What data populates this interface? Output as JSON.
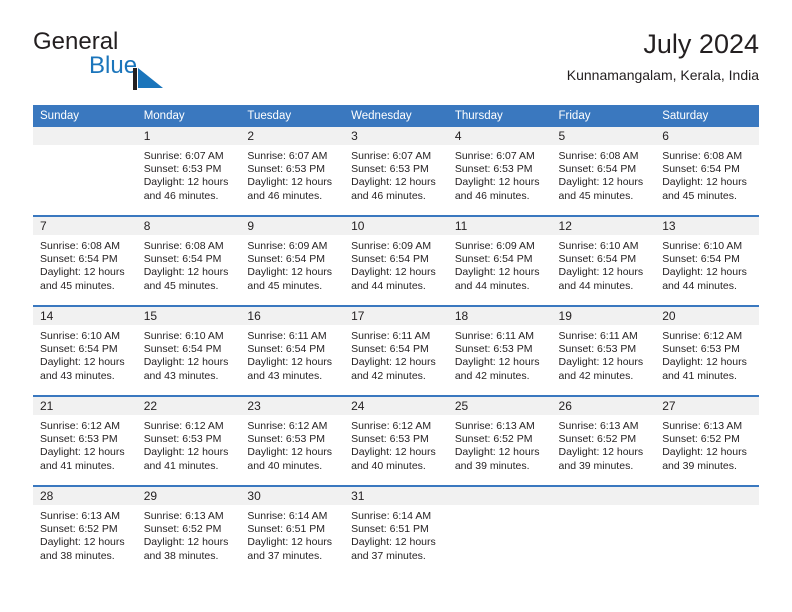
{
  "brand": {
    "name_part1": "General",
    "name_part2": "Blue",
    "logo_icon": "triangle-flag-icon",
    "accent_color": "#1b75bb"
  },
  "header": {
    "title": "July 2024",
    "subtitle": "Kunnamangalam, Kerala, India"
  },
  "theme": {
    "header_row_bg": "#3a78bf",
    "daynum_band_bg": "#f1f1f1",
    "text_color": "#231f20"
  },
  "calendar": {
    "weekday_headers": [
      "Sunday",
      "Monday",
      "Tuesday",
      "Wednesday",
      "Thursday",
      "Friday",
      "Saturday"
    ],
    "weeks": [
      [
        {
          "day": "",
          "sunrise": "",
          "sunset": "",
          "daylight_line1": "",
          "daylight_line2": ""
        },
        {
          "day": "1",
          "sunrise": "Sunrise: 6:07 AM",
          "sunset": "Sunset: 6:53 PM",
          "daylight_line1": "Daylight: 12 hours",
          "daylight_line2": "and 46 minutes."
        },
        {
          "day": "2",
          "sunrise": "Sunrise: 6:07 AM",
          "sunset": "Sunset: 6:53 PM",
          "daylight_line1": "Daylight: 12 hours",
          "daylight_line2": "and 46 minutes."
        },
        {
          "day": "3",
          "sunrise": "Sunrise: 6:07 AM",
          "sunset": "Sunset: 6:53 PM",
          "daylight_line1": "Daylight: 12 hours",
          "daylight_line2": "and 46 minutes."
        },
        {
          "day": "4",
          "sunrise": "Sunrise: 6:07 AM",
          "sunset": "Sunset: 6:53 PM",
          "daylight_line1": "Daylight: 12 hours",
          "daylight_line2": "and 46 minutes."
        },
        {
          "day": "5",
          "sunrise": "Sunrise: 6:08 AM",
          "sunset": "Sunset: 6:54 PM",
          "daylight_line1": "Daylight: 12 hours",
          "daylight_line2": "and 45 minutes."
        },
        {
          "day": "6",
          "sunrise": "Sunrise: 6:08 AM",
          "sunset": "Sunset: 6:54 PM",
          "daylight_line1": "Daylight: 12 hours",
          "daylight_line2": "and 45 minutes."
        }
      ],
      [
        {
          "day": "7",
          "sunrise": "Sunrise: 6:08 AM",
          "sunset": "Sunset: 6:54 PM",
          "daylight_line1": "Daylight: 12 hours",
          "daylight_line2": "and 45 minutes."
        },
        {
          "day": "8",
          "sunrise": "Sunrise: 6:08 AM",
          "sunset": "Sunset: 6:54 PM",
          "daylight_line1": "Daylight: 12 hours",
          "daylight_line2": "and 45 minutes."
        },
        {
          "day": "9",
          "sunrise": "Sunrise: 6:09 AM",
          "sunset": "Sunset: 6:54 PM",
          "daylight_line1": "Daylight: 12 hours",
          "daylight_line2": "and 45 minutes."
        },
        {
          "day": "10",
          "sunrise": "Sunrise: 6:09 AM",
          "sunset": "Sunset: 6:54 PM",
          "daylight_line1": "Daylight: 12 hours",
          "daylight_line2": "and 44 minutes."
        },
        {
          "day": "11",
          "sunrise": "Sunrise: 6:09 AM",
          "sunset": "Sunset: 6:54 PM",
          "daylight_line1": "Daylight: 12 hours",
          "daylight_line2": "and 44 minutes."
        },
        {
          "day": "12",
          "sunrise": "Sunrise: 6:10 AM",
          "sunset": "Sunset: 6:54 PM",
          "daylight_line1": "Daylight: 12 hours",
          "daylight_line2": "and 44 minutes."
        },
        {
          "day": "13",
          "sunrise": "Sunrise: 6:10 AM",
          "sunset": "Sunset: 6:54 PM",
          "daylight_line1": "Daylight: 12 hours",
          "daylight_line2": "and 44 minutes."
        }
      ],
      [
        {
          "day": "14",
          "sunrise": "Sunrise: 6:10 AM",
          "sunset": "Sunset: 6:54 PM",
          "daylight_line1": "Daylight: 12 hours",
          "daylight_line2": "and 43 minutes."
        },
        {
          "day": "15",
          "sunrise": "Sunrise: 6:10 AM",
          "sunset": "Sunset: 6:54 PM",
          "daylight_line1": "Daylight: 12 hours",
          "daylight_line2": "and 43 minutes."
        },
        {
          "day": "16",
          "sunrise": "Sunrise: 6:11 AM",
          "sunset": "Sunset: 6:54 PM",
          "daylight_line1": "Daylight: 12 hours",
          "daylight_line2": "and 43 minutes."
        },
        {
          "day": "17",
          "sunrise": "Sunrise: 6:11 AM",
          "sunset": "Sunset: 6:54 PM",
          "daylight_line1": "Daylight: 12 hours",
          "daylight_line2": "and 42 minutes."
        },
        {
          "day": "18",
          "sunrise": "Sunrise: 6:11 AM",
          "sunset": "Sunset: 6:53 PM",
          "daylight_line1": "Daylight: 12 hours",
          "daylight_line2": "and 42 minutes."
        },
        {
          "day": "19",
          "sunrise": "Sunrise: 6:11 AM",
          "sunset": "Sunset: 6:53 PM",
          "daylight_line1": "Daylight: 12 hours",
          "daylight_line2": "and 42 minutes."
        },
        {
          "day": "20",
          "sunrise": "Sunrise: 6:12 AM",
          "sunset": "Sunset: 6:53 PM",
          "daylight_line1": "Daylight: 12 hours",
          "daylight_line2": "and 41 minutes."
        }
      ],
      [
        {
          "day": "21",
          "sunrise": "Sunrise: 6:12 AM",
          "sunset": "Sunset: 6:53 PM",
          "daylight_line1": "Daylight: 12 hours",
          "daylight_line2": "and 41 minutes."
        },
        {
          "day": "22",
          "sunrise": "Sunrise: 6:12 AM",
          "sunset": "Sunset: 6:53 PM",
          "daylight_line1": "Daylight: 12 hours",
          "daylight_line2": "and 41 minutes."
        },
        {
          "day": "23",
          "sunrise": "Sunrise: 6:12 AM",
          "sunset": "Sunset: 6:53 PM",
          "daylight_line1": "Daylight: 12 hours",
          "daylight_line2": "and 40 minutes."
        },
        {
          "day": "24",
          "sunrise": "Sunrise: 6:12 AM",
          "sunset": "Sunset: 6:53 PM",
          "daylight_line1": "Daylight: 12 hours",
          "daylight_line2": "and 40 minutes."
        },
        {
          "day": "25",
          "sunrise": "Sunrise: 6:13 AM",
          "sunset": "Sunset: 6:52 PM",
          "daylight_line1": "Daylight: 12 hours",
          "daylight_line2": "and 39 minutes."
        },
        {
          "day": "26",
          "sunrise": "Sunrise: 6:13 AM",
          "sunset": "Sunset: 6:52 PM",
          "daylight_line1": "Daylight: 12 hours",
          "daylight_line2": "and 39 minutes."
        },
        {
          "day": "27",
          "sunrise": "Sunrise: 6:13 AM",
          "sunset": "Sunset: 6:52 PM",
          "daylight_line1": "Daylight: 12 hours",
          "daylight_line2": "and 39 minutes."
        }
      ],
      [
        {
          "day": "28",
          "sunrise": "Sunrise: 6:13 AM",
          "sunset": "Sunset: 6:52 PM",
          "daylight_line1": "Daylight: 12 hours",
          "daylight_line2": "and 38 minutes."
        },
        {
          "day": "29",
          "sunrise": "Sunrise: 6:13 AM",
          "sunset": "Sunset: 6:52 PM",
          "daylight_line1": "Daylight: 12 hours",
          "daylight_line2": "and 38 minutes."
        },
        {
          "day": "30",
          "sunrise": "Sunrise: 6:14 AM",
          "sunset": "Sunset: 6:51 PM",
          "daylight_line1": "Daylight: 12 hours",
          "daylight_line2": "and 37 minutes."
        },
        {
          "day": "31",
          "sunrise": "Sunrise: 6:14 AM",
          "sunset": "Sunset: 6:51 PM",
          "daylight_line1": "Daylight: 12 hours",
          "daylight_line2": "and 37 minutes."
        },
        {
          "day": "",
          "sunrise": "",
          "sunset": "",
          "daylight_line1": "",
          "daylight_line2": ""
        },
        {
          "day": "",
          "sunrise": "",
          "sunset": "",
          "daylight_line1": "",
          "daylight_line2": ""
        },
        {
          "day": "",
          "sunrise": "",
          "sunset": "",
          "daylight_line1": "",
          "daylight_line2": ""
        }
      ]
    ]
  }
}
